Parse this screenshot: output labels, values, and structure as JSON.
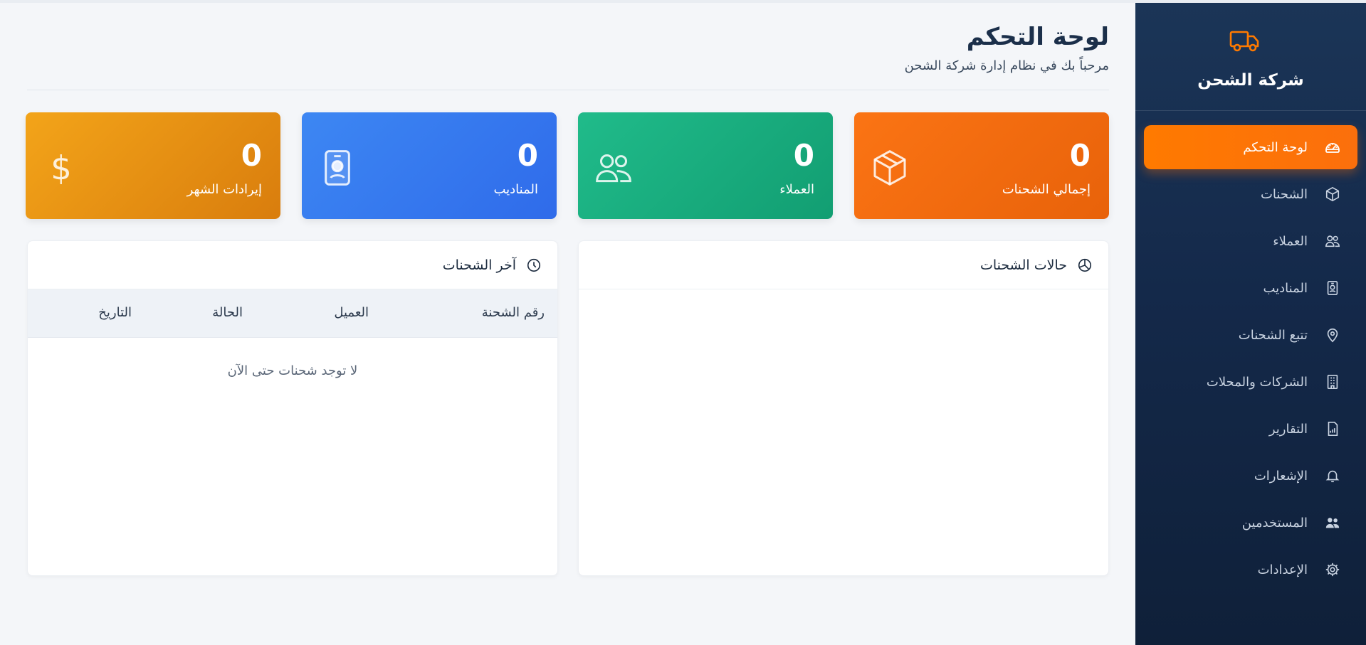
{
  "brand": {
    "name": "شركة الشحن",
    "icon": "truck-icon",
    "icon_color": "#ff7a00"
  },
  "sidebar": {
    "items": [
      {
        "label": "لوحة التحكم",
        "icon": "speedometer-icon",
        "active": true
      },
      {
        "label": "الشحنات",
        "icon": "box-icon",
        "active": false
      },
      {
        "label": "العملاء",
        "icon": "people-icon",
        "active": false
      },
      {
        "label": "المناديب",
        "icon": "badge-icon",
        "active": false
      },
      {
        "label": "تتبع الشحنات",
        "icon": "map-pin-icon",
        "active": false
      },
      {
        "label": "الشركات والمحلات",
        "icon": "building-icon",
        "active": false
      },
      {
        "label": "التقارير",
        "icon": "report-icon",
        "active": false
      },
      {
        "label": "الإشعارات",
        "icon": "bell-icon",
        "active": false
      },
      {
        "label": "المستخدمين",
        "icon": "users-icon",
        "active": false
      },
      {
        "label": "الإعدادات",
        "icon": "gear-icon",
        "active": false
      }
    ]
  },
  "header": {
    "title": "لوحة التحكم",
    "subtitle": "مرحباً بك في نظام إدارة شركة الشحن"
  },
  "stats": [
    {
      "value": "0",
      "label": "إجمالي الشحنات",
      "icon": "box-icon",
      "color": "#fb7414"
    },
    {
      "value": "0",
      "label": "العملاء",
      "icon": "people-icon",
      "color": "#20bb8a"
    },
    {
      "value": "0",
      "label": "المناديب",
      "icon": "badge-icon",
      "color": "#3d87f3"
    },
    {
      "value": "0",
      "label": "إيرادات الشهر",
      "icon": "dollar-icon",
      "color": "#f3a419"
    }
  ],
  "status_panel": {
    "title": "حالات الشحنات",
    "icon": "pie-chart-icon"
  },
  "recent_panel": {
    "title": "آخر الشحنات",
    "icon": "clock-icon",
    "columns": [
      "رقم الشحنة",
      "العميل",
      "الحالة",
      "التاريخ"
    ],
    "empty_message": "لا توجد شحنات حتى الآن"
  }
}
